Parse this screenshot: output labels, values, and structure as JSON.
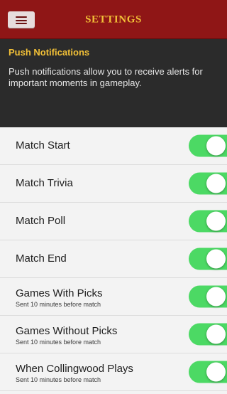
{
  "header": {
    "title": "SETTINGS",
    "menu_icon": "hamburger-menu-icon"
  },
  "notice": {
    "title": "Push Notifications",
    "body": "Push notifications allow you to receive alerts for important moments in gameplay."
  },
  "colors": {
    "header_bg": "#8f1616",
    "accent_gold": "#f2c037",
    "notice_bg": "#2b2b2b",
    "toggle_on": "#4cd964"
  },
  "settings": [
    {
      "label": "Match Start",
      "subtitle": "",
      "enabled": true
    },
    {
      "label": "Match Trivia",
      "subtitle": "",
      "enabled": true
    },
    {
      "label": "Match Poll",
      "subtitle": "",
      "enabled": true
    },
    {
      "label": "Match End",
      "subtitle": "",
      "enabled": true
    },
    {
      "label": "Games With Picks",
      "subtitle": "Sent 10 minutes before match",
      "enabled": true
    },
    {
      "label": "Games Without Picks",
      "subtitle": "Sent 10 minutes before match",
      "enabled": true
    },
    {
      "label": "When Collingwood Plays",
      "subtitle": "Sent 10 minutes before match",
      "enabled": true
    }
  ]
}
